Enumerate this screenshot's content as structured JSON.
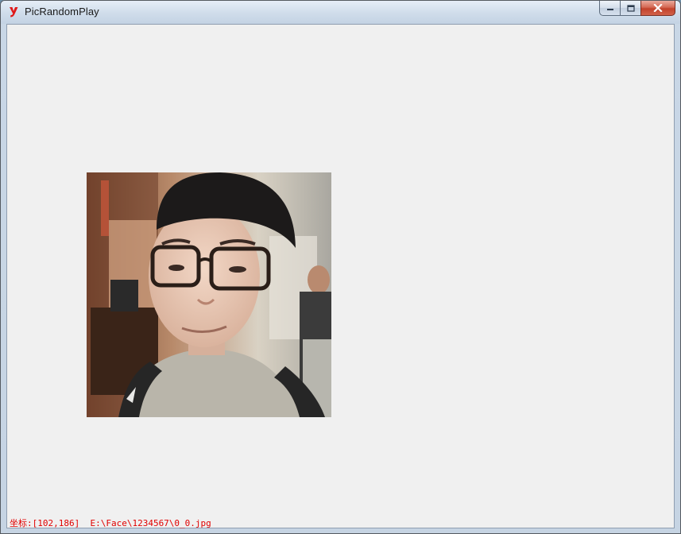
{
  "window": {
    "title": "PicRandomPlay",
    "app_icon": "y-logo-icon",
    "controls": [
      "minimize-icon",
      "maximize-icon",
      "close-icon"
    ]
  },
  "image": {
    "description_label": "photo"
  },
  "status": {
    "text": "坐标:[102,186]  E:\\Face\\1234567\\0_0.jpg"
  },
  "colors": {
    "client_bg": "#f0f0f0",
    "status_text": "#e00000",
    "close_button": "#c2422b"
  }
}
